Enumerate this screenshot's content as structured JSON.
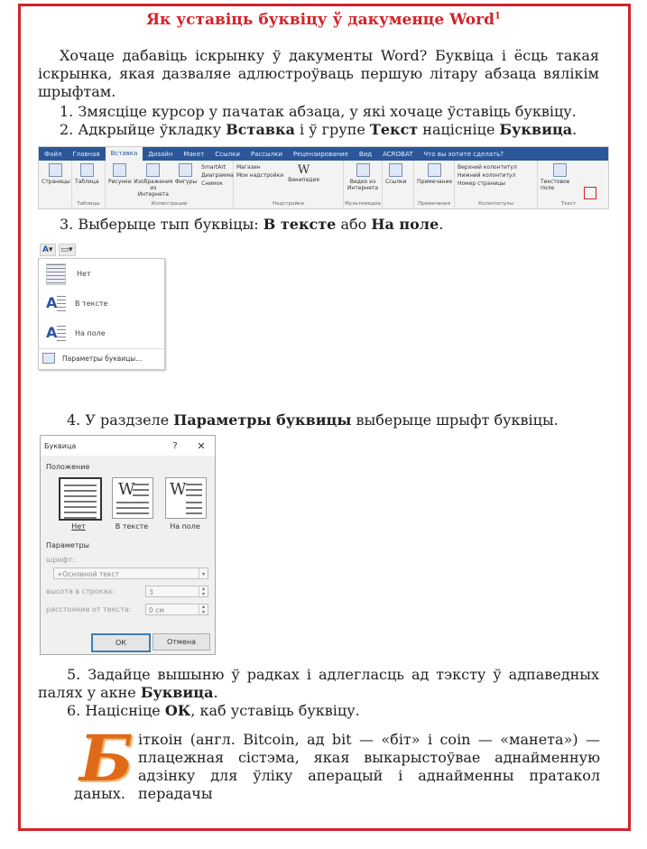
{
  "heading": {
    "text": "Як уставіць буквіцу ў дакуменце Word",
    "footnote_mark": "1"
  },
  "intro": {
    "text": "Хочаце дабавіць іскрынку ў дакументы Word? Буквіца і ёсць такая іскрынка, якая дазваляе адлюстроўваць першую літару абзаца вялікім шрыфтам."
  },
  "steps": {
    "s1": "1. Змясціце курсор у пачатак абзаца, у які хочаце ўставіць буквіцу.",
    "s2_a": "2. Адкрыйце ўкладку ",
    "s2_b": "Вставка",
    "s2_c": " і ў групе ",
    "s2_d": "Текст",
    "s2_e": " націсніце ",
    "s2_f": "Буквица",
    "s2_g": ".",
    "s3_a": "3. Выберыце тып буквіцы: ",
    "s3_b": "В тексте",
    "s3_c": " або ",
    "s3_d": "На поле",
    "s3_e": ".",
    "s4_a": "4. У раздзеле ",
    "s4_b": "Параметры буквицы",
    "s4_c": " выберыце шрыфт буквіцы.",
    "s5_a": "5. Задайце вышыню ў радках і адлегласць ад тэксту ў адпаведных палях у акне ",
    "s5_b": "Буквица",
    "s5_c": ".",
    "s6_a": "6. Націсніце ",
    "s6_b": "ОК",
    "s6_c": ", каб уставіць буквіцу."
  },
  "ribbon": {
    "tabs": [
      "Файл",
      "Главная",
      "Вставка",
      "Дизайн",
      "Макет",
      "Ссылки",
      "Рассылки",
      "Рецензирование",
      "Вид",
      "ACROBAT",
      "Что вы хотите сделать?"
    ],
    "active_tab": "Вставка",
    "pages_label": "Страницы",
    "table_label": "Таблица",
    "tables_group": "Таблицы",
    "pictures": "Рисунки",
    "online_pictures": "Изображения из Интернета",
    "shapes": "Фигуры",
    "smartart": "SmartArt",
    "diagram": "Диаграмма",
    "snapshot": "Снимок",
    "illustrations_group": "Иллюстрации",
    "store": "Магазин",
    "my_addins": "Мои надстройки",
    "wikipedia": "Википедия",
    "addins_group": "Надстройки",
    "online_video": "Видео из Интернета",
    "media_group": "Мультимедиа",
    "links": "Ссылки",
    "comment": "Примечание",
    "comments_group": "Примечания",
    "header": "Верхний колонтитул",
    "footer": "Нижний колонтитул",
    "page_number": "Номер страницы",
    "hf_group": "Колонтитулы",
    "textbox": "Текстовое поле",
    "text_group": "Текст"
  },
  "dropcap_menu": {
    "items": [
      "Нет",
      "В тексте",
      "На поле"
    ],
    "footer": "Параметры буквицы..."
  },
  "dialog": {
    "title": "Буквица",
    "help": "?",
    "close": "✕",
    "position_label": "Положение",
    "options": [
      "Нет",
      "В тексте",
      "На поле"
    ],
    "params_label": "Параметры",
    "font_label": "шрифт:",
    "font_value": "+Основной текст",
    "height_label": "высота в строках:",
    "height_value": "3",
    "distance_label": "расстояние от текста:",
    "distance_value": "0 см",
    "ok": "ОК",
    "cancel": "Отмена"
  },
  "example": {
    "dropcap_letter": "Б",
    "line1": "іткоін (англ. Bitcoin, ад bit — «біт» і coin — «манета») —",
    "line2": "плацежная сістэма, якая выкарыстоўвае аднайменную",
    "line3": "адзінку для ўліку аперацый і аднайменны пратакол перадачы",
    "line4": "даных."
  }
}
